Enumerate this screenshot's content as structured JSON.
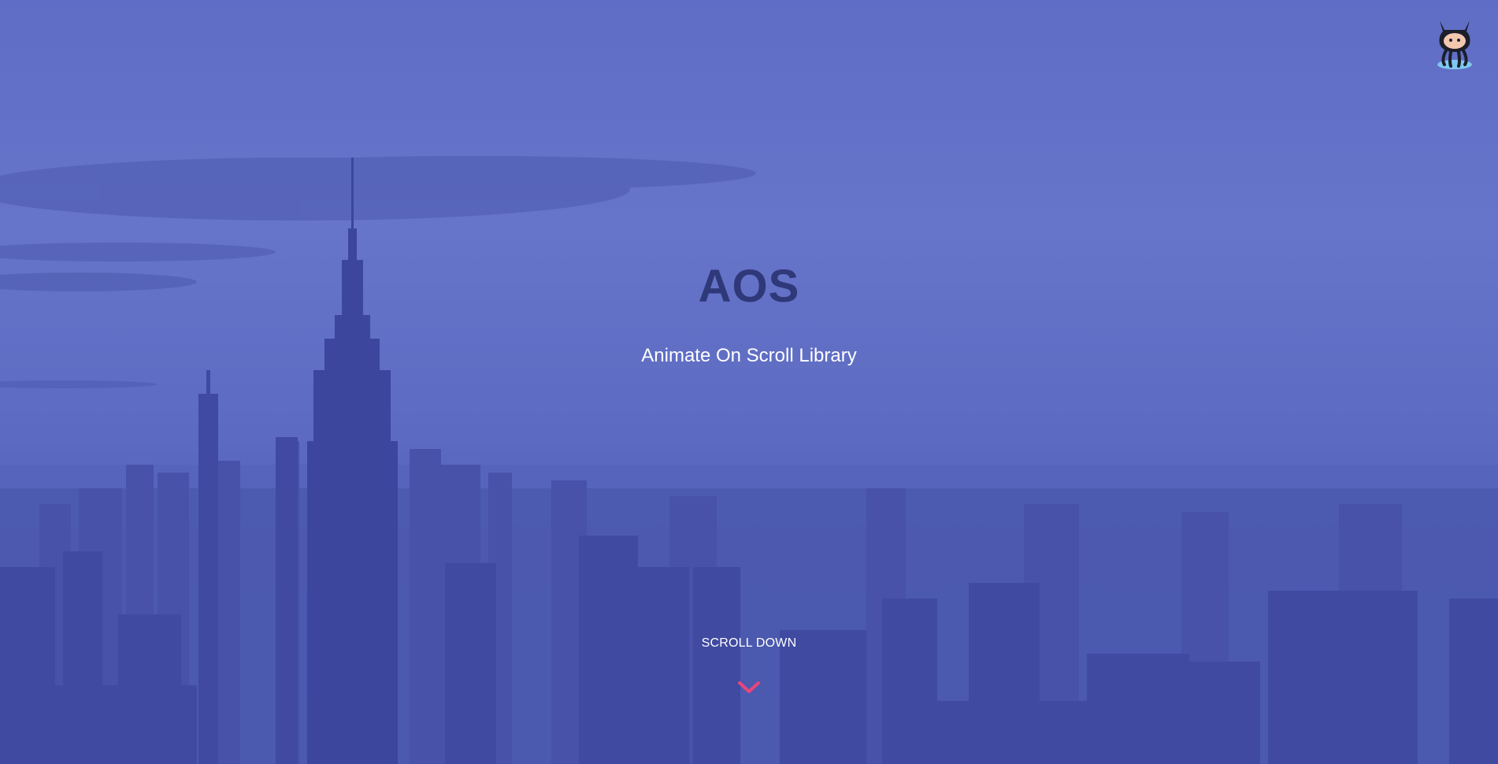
{
  "hero": {
    "title": "AOS",
    "subtitle": "Animate On Scroll Library",
    "scroll_label": "SCROLL DOWN"
  },
  "icons": {
    "github": "octocat-icon",
    "scroll": "chevron-down-icon"
  },
  "colors": {
    "overlay": "#5f6dc6",
    "title": "#2f3878",
    "text": "#ffffff",
    "accent": "#e8467c"
  }
}
